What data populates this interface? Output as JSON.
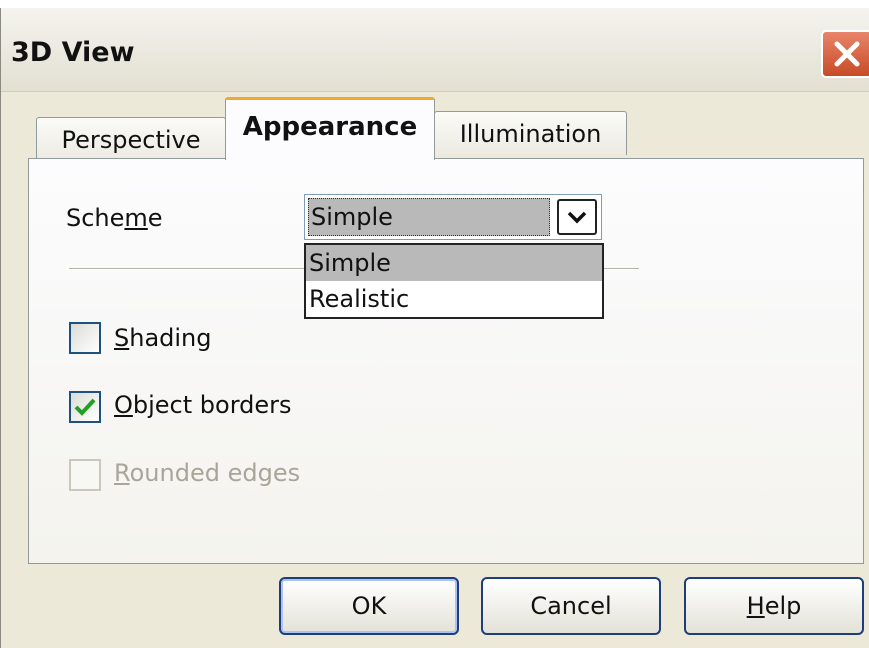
{
  "window": {
    "title": "3D View",
    "close_icon": "close-icon"
  },
  "tabs": [
    {
      "label": "Perspective",
      "active": false
    },
    {
      "label": "Appearance",
      "active": true
    },
    {
      "label": "Illumination",
      "active": false
    }
  ],
  "scheme": {
    "label_pre": "Sche",
    "label_mnemonic": "m",
    "label_post": "e",
    "value": "Simple",
    "options": [
      "Simple",
      "Realistic"
    ],
    "selected_index": 0
  },
  "checkboxes": {
    "shading": {
      "mnemonic": "S",
      "rest": "hading",
      "checked": false,
      "enabled": true
    },
    "object_borders": {
      "mnemonic": "O",
      "rest": "bject borders",
      "checked": true,
      "enabled": true
    },
    "rounded_edges": {
      "mnemonic": "R",
      "rest": "ounded edges",
      "checked": false,
      "enabled": false
    }
  },
  "buttons": {
    "ok": "OK",
    "cancel": "Cancel",
    "help_mnemonic": "H",
    "help_rest": "elp"
  },
  "colors": {
    "dialog_bg": "#ece9d8",
    "tab_accent": "#f0a830",
    "selection": "#b9b9b9",
    "checkmark": "#21a121",
    "close_button": "#c74b26"
  }
}
